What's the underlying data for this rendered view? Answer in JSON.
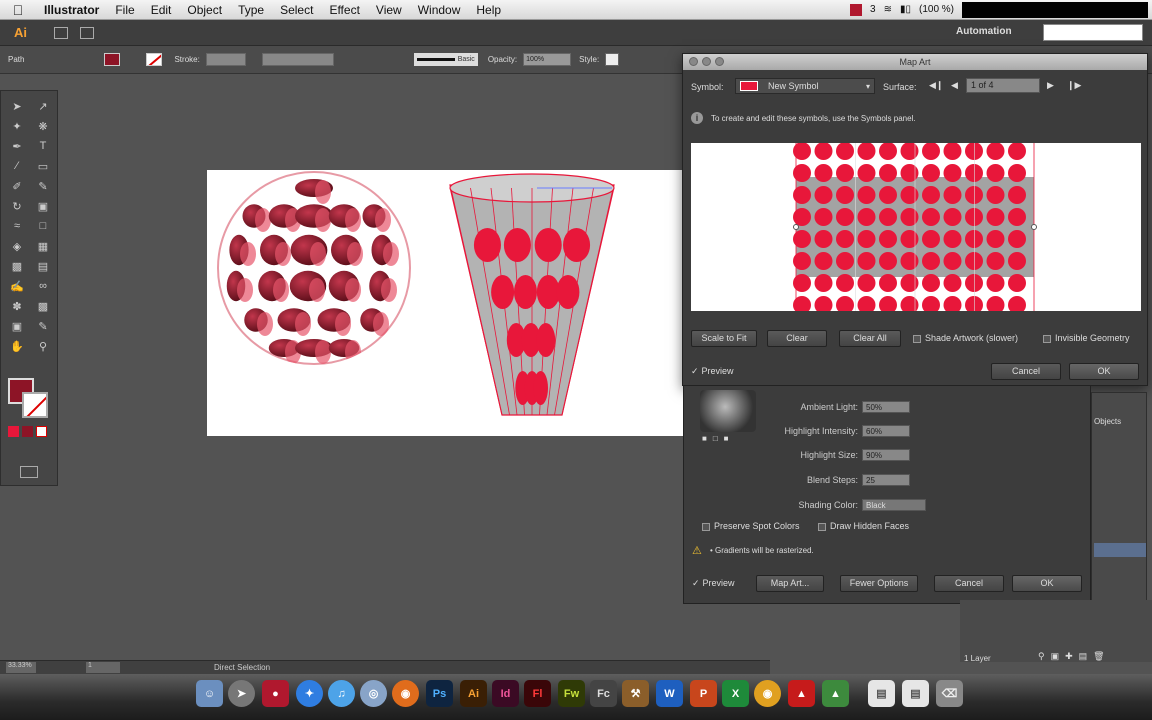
{
  "menubar": {
    "app": "Illustrator",
    "items": [
      "File",
      "Edit",
      "Object",
      "Type",
      "Select",
      "Effect",
      "View",
      "Window",
      "Help"
    ],
    "battery": "(100 %)",
    "badge": "3"
  },
  "appbar": {
    "logo": "Ai",
    "workspace": "Automation"
  },
  "controlbar": {
    "selection": "Path",
    "stroke_label": "Stroke:",
    "brush": "Basic",
    "opacity_label": "Opacity:",
    "opacity": "100%",
    "style_label": "Style:"
  },
  "mapart": {
    "title": "Map Art",
    "symbol_label": "Symbol:",
    "symbol_value": "New Symbol",
    "surface_label": "Surface:",
    "surface_value": "1 of 4",
    "info": "To create and edit these symbols, use the Symbols panel.",
    "scale_to_fit": "Scale to Fit",
    "clear": "Clear",
    "clear_all": "Clear All",
    "shade_artwork": "Shade Artwork (slower)",
    "invisible_geometry": "Invisible Geometry",
    "preview": "Preview",
    "cancel": "Cancel",
    "ok": "OK"
  },
  "threed": {
    "ambient_label": "Ambient Light:",
    "ambient": "50%",
    "highlight_intensity_label": "Highlight Intensity:",
    "highlight_intensity": "60%",
    "highlight_size_label": "Highlight Size:",
    "highlight_size": "90%",
    "blend_steps_label": "Blend Steps:",
    "blend_steps": "25",
    "shading_color_label": "Shading Color:",
    "shading_color": "Black",
    "preserve_spot": "Preserve Spot Colors",
    "draw_hidden": "Draw Hidden Faces",
    "warning": "• Gradients will be rasterized.",
    "preview": "Preview",
    "map_art": "Map Art...",
    "fewer_options": "Fewer Options",
    "cancel": "Cancel",
    "ok": "OK"
  },
  "panels": {
    "objects_tab": "Objects",
    "layers_count": "1 Layer"
  },
  "statusbar": {
    "zoom": "33.33%",
    "page": "1",
    "tool": "Direct Selection"
  },
  "dock": [
    "Ps",
    "Ai",
    "Id",
    "Fl",
    "Fw",
    "Fc",
    "W",
    "P",
    "X"
  ],
  "colors": {
    "accent_red": "#e8173a",
    "dark_red": "#8d1426",
    "ai_orange": "#f7a133"
  }
}
